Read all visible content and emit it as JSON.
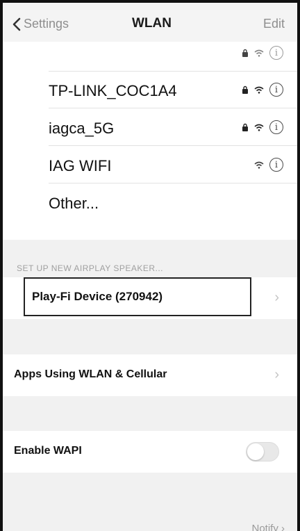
{
  "navbar": {
    "back_label": "Settings",
    "title": "WLAN",
    "edit_label": "Edit"
  },
  "networks": [
    {
      "name": "",
      "locked": true,
      "signal": true,
      "faded": true
    },
    {
      "name": "TP-LINK_COC1A4",
      "locked": true,
      "signal": true,
      "faded": false
    },
    {
      "name": "iagca_5G",
      "locked": true,
      "signal": true,
      "faded": false
    },
    {
      "name": "IAG WIFI",
      "locked": false,
      "signal": true,
      "faded": false
    },
    {
      "name": "Other...",
      "locked": false,
      "signal": false,
      "faded": false
    }
  ],
  "airplay": {
    "section_header": "SET UP NEW AIRPLAY SPEAKER...",
    "device_label": "Play-Fi Device (270942)"
  },
  "apps_row": {
    "label": "Apps Using WLAN & Cellular"
  },
  "wapi_row": {
    "label": "Enable WAPI",
    "enabled": false
  },
  "footer": {
    "notify_label": "Notify"
  },
  "colors": {
    "background": "#f1f1f1",
    "nav_gray": "#8e8e8e",
    "text": "#111111",
    "frame": "#111111"
  }
}
